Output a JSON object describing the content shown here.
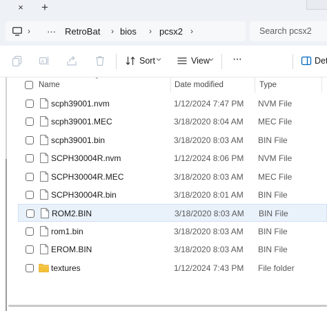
{
  "tabbar": {
    "close_glyph": "×",
    "new_tab_glyph": "+"
  },
  "address": {
    "icon": "pc-icon",
    "more": "···",
    "crumbs": [
      "RetroBat",
      "bios",
      "pcsx2"
    ],
    "separator": "›"
  },
  "search": {
    "placeholder": "Search pcsx2"
  },
  "toolbar": {
    "icons": [
      "copy-icon",
      "rename-icon",
      "share-icon",
      "delete-icon"
    ],
    "sort_label": "Sort",
    "view_label": "View",
    "more": "···",
    "details_label": "Det"
  },
  "columns": {
    "name": "Name",
    "date": "Date modified",
    "type": "Type"
  },
  "files": [
    {
      "name": "scph39001.nvm",
      "date": "1/12/2024 7:47 PM",
      "type": "NVM File",
      "icon": "file-icon"
    },
    {
      "name": "scph39001.MEC",
      "date": "3/18/2020 8:04 AM",
      "type": "MEC File",
      "icon": "file-icon"
    },
    {
      "name": "scph39001.bin",
      "date": "3/18/2020 8:03 AM",
      "type": "BIN File",
      "icon": "file-icon"
    },
    {
      "name": "SCPH30004R.nvm",
      "date": "1/12/2024 8:06 PM",
      "type": "NVM File",
      "icon": "file-icon"
    },
    {
      "name": "SCPH30004R.MEC",
      "date": "3/18/2020 8:03 AM",
      "type": "MEC File",
      "icon": "file-icon"
    },
    {
      "name": "SCPH30004R.bin",
      "date": "3/18/2020 8:01 AM",
      "type": "BIN File",
      "icon": "file-icon"
    },
    {
      "name": "ROM2.BIN",
      "date": "3/18/2020 8:03 AM",
      "type": "BIN File",
      "icon": "file-icon",
      "selected": true
    },
    {
      "name": "rom1.bin",
      "date": "3/18/2020 8:03 AM",
      "type": "BIN File",
      "icon": "file-icon"
    },
    {
      "name": "EROM.BIN",
      "date": "3/18/2020 8:03 AM",
      "type": "BIN File",
      "icon": "file-icon"
    },
    {
      "name": "textures",
      "date": "1/12/2024 7:43 PM",
      "type": "File folder",
      "icon": "folder-icon"
    }
  ],
  "colors": {
    "selection": "#e9f1fb",
    "folder": "#f3c03a",
    "accent": "#0067c0"
  }
}
